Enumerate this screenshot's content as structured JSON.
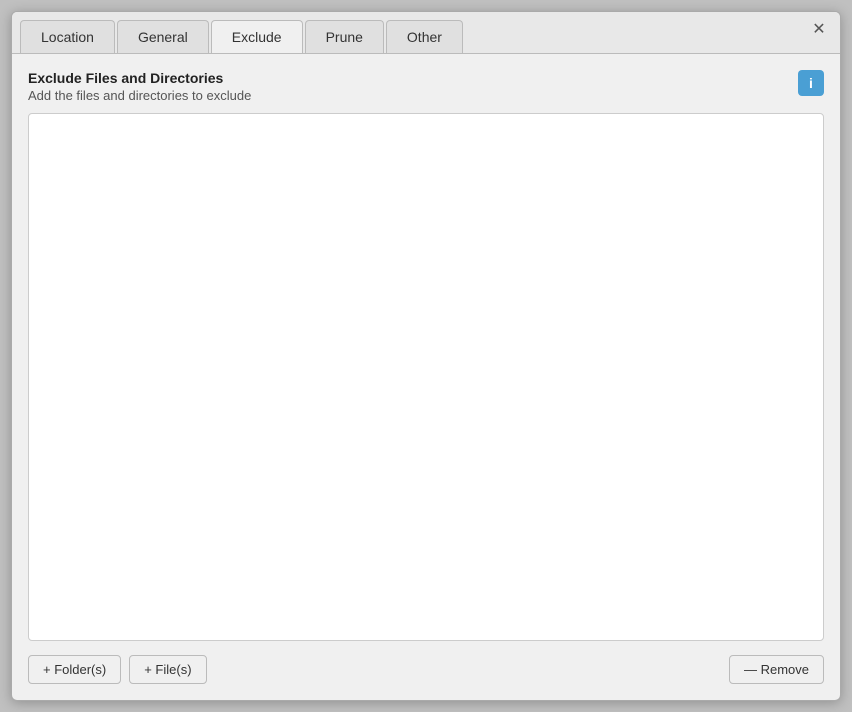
{
  "tabs": [
    {
      "id": "location",
      "label": "Location",
      "active": false
    },
    {
      "id": "general",
      "label": "General",
      "active": false
    },
    {
      "id": "exclude",
      "label": "Exclude",
      "active": true
    },
    {
      "id": "prune",
      "label": "Prune",
      "active": false
    },
    {
      "id": "other",
      "label": "Other",
      "active": false
    }
  ],
  "close_button_symbol": "✕",
  "section": {
    "title": "Exclude Files and Directories",
    "subtitle": "Add the files and directories to exclude",
    "info_symbol": "i"
  },
  "buttons": {
    "add_folder": "+ Folder(s)",
    "add_file": "+ File(s)",
    "remove": "— Remove"
  }
}
